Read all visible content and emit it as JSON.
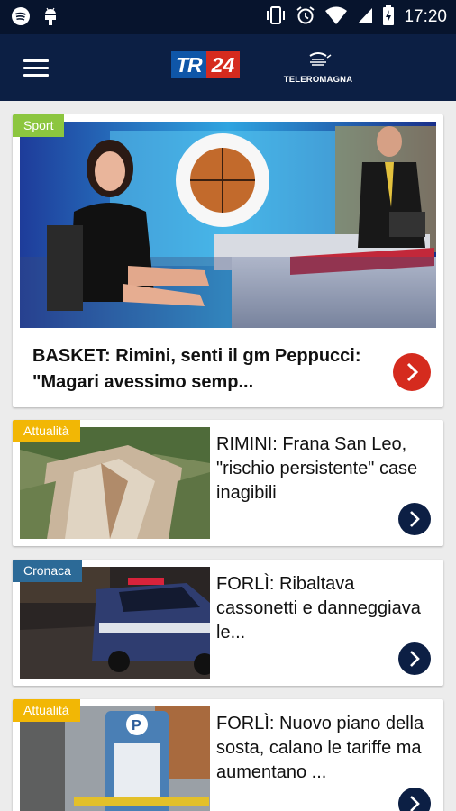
{
  "status_bar": {
    "time": "17:20",
    "left_icons": [
      "spotify-icon",
      "android-icon"
    ],
    "right_icons": [
      "vibrate-icon",
      "alarm-icon",
      "wifi-icon",
      "signal-icon",
      "battery-icon"
    ]
  },
  "header": {
    "menu_icon": "hamburger-icon",
    "logo_tr": "TR",
    "logo_24": "24",
    "partner_logo": "TELEROMAGNA"
  },
  "colors": {
    "header_bg": "#0c1f44",
    "status_bg": "#07142d",
    "sport_tag": "#8cc63f",
    "attualita_tag": "#f2b705",
    "cronaca_tag": "#2c6a97",
    "accent_red": "#d52b1e"
  },
  "featured": {
    "category": "Sport",
    "title": "BASKET: Rimini, senti il gm Peppucci: \"Magari avessimo semp...",
    "action_icon": "chevron-right-icon"
  },
  "articles": [
    {
      "category": "Attualità",
      "title": "RIMINI: Frana San Leo, \"rischio persistente\" case inagibili",
      "action_icon": "chevron-right-icon"
    },
    {
      "category": "Cronaca",
      "title": "FORLÌ: Ribaltava cassonetti e danneggiava le...",
      "action_icon": "chevron-right-icon"
    },
    {
      "category": "Attualità",
      "title": "FORLÌ: Nuovo piano della sosta, calano le tariffe ma aumentano ...",
      "action_icon": "chevron-right-icon"
    }
  ]
}
